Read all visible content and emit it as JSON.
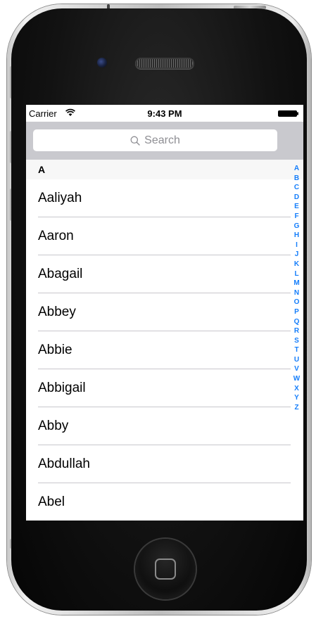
{
  "status_bar": {
    "carrier": "Carrier",
    "time": "9:43 PM"
  },
  "search": {
    "placeholder": "Search"
  },
  "section": {
    "title": "A"
  },
  "rows": [
    "Aaliyah",
    "Aaron",
    "Abagail",
    "Abbey",
    "Abbie",
    "Abbigail",
    "Abby",
    "Abdullah",
    "Abel"
  ],
  "index_letters": [
    "A",
    "B",
    "C",
    "D",
    "E",
    "F",
    "G",
    "H",
    "I",
    "J",
    "K",
    "L",
    "M",
    "N",
    "O",
    "P",
    "Q",
    "R",
    "S",
    "T",
    "U",
    "V",
    "W",
    "X",
    "Y",
    "Z"
  ],
  "colors": {
    "accent": "#157efb",
    "search_bar_bg": "#c9c9ce",
    "section_header_bg": "#f7f7f7",
    "separator": "#c8c7cc"
  },
  "icons": {
    "wifi": "wifi-icon",
    "battery": "battery-icon",
    "search": "search-icon",
    "home": "home-button-icon"
  }
}
